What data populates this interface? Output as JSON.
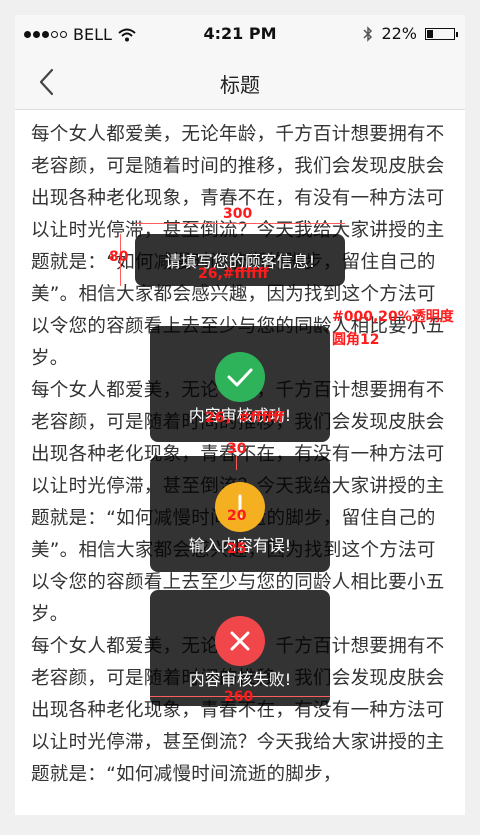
{
  "status_bar": {
    "carrier": "BELL",
    "time": "4:21 PM",
    "battery": "22%",
    "battery_level": 0.22
  },
  "nav": {
    "title": "标题"
  },
  "content": {
    "paragraphs": [
      "每个女人都爱美，无论年龄，千方百计想要拥有不老容颜，可是随着时间的推移，我们会发现皮肤会出现各种老化现象，青春不在，有没有一种方法可以让时光停滞，甚至倒流？今天我给大家讲授的主题就是：“如何减慢时间流逝的脚步，留住自己的美”。相信大家都会感兴趣，因为找到这个方法可以令您的容颜看上去至少与您的同龄人相比要小五岁。",
      "每个女人都爱美，无论年龄，千方百计想要拥有不老容颜，可是随着时间的推移，我们会发现皮肤会出现各种老化现象，青春不在，有没有一种方法可以让时光停滞，甚至倒流？今天我给大家讲授的主题就是：“如何减慢时间流逝的脚步，留住自己的美”。相信大家都会感兴趣，因为找到这个方法可以令您的容颜看上去至少与您的同龄人相比要小五岁。",
      "每个女人都爱美，无论年龄，千方百计想要拥有不老容颜，可是随着时间的推移，我们会发现皮肤会出现各种老化现象，青春不在，有没有一种方法可以让时光停滞，甚至倒流？今天我给大家讲授的主题就是：“如何减慢时间流逝的脚步，"
    ]
  },
  "toasts": {
    "info": {
      "text": "请填写您的顾客信息!"
    },
    "success": {
      "text": "内容审核成功!",
      "icon": "check-icon",
      "color": "#2fb35a"
    },
    "warning": {
      "text": "输入内容有误!",
      "icon": "exclamation-icon",
      "color": "#f4b021"
    },
    "error": {
      "text": "内容审核失败!",
      "icon": "close-icon",
      "color": "#f1474b"
    }
  },
  "annotations": {
    "a300": "300",
    "a80": "80",
    "a26": "26,#ffffff",
    "abg": "#000,20%透明度",
    "aradius": "圆角12",
    "a26b": "26，#ffffff",
    "a30": "30",
    "a20": "20",
    "a25": "25",
    "a260": "260"
  }
}
